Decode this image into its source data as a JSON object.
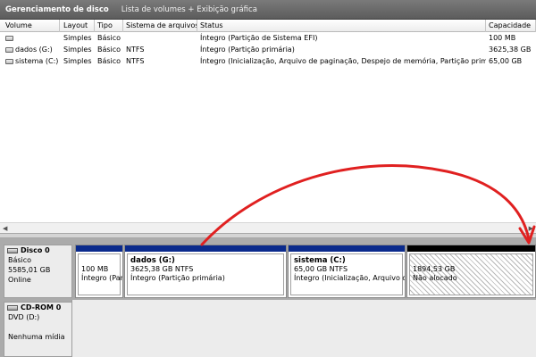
{
  "window": {
    "title": "Gerenciamento de disco",
    "view": "Lista de volumes + Exibição gráfica"
  },
  "list": {
    "columns": [
      "Volume",
      "Layout",
      "Tipo",
      "Sistema de arquivos",
      "Status",
      "Capacidade"
    ],
    "rows": [
      {
        "volume": "",
        "layout": "Simples",
        "tipo": "Básico",
        "fs": "",
        "status": "Íntegro (Partição de Sistema EFI)",
        "cap": "100 MB"
      },
      {
        "volume": "dados (G:)",
        "layout": "Simples",
        "tipo": "Básico",
        "fs": "NTFS",
        "status": "Íntegro (Partição primária)",
        "cap": "3625,38 GB"
      },
      {
        "volume": "sistema (C:)",
        "layout": "Simples",
        "tipo": "Básico",
        "fs": "NTFS",
        "status": "Íntegro (Inicialização, Arquivo de paginação, Despejo de memória, Partição primária)",
        "cap": "65,00 GB"
      }
    ]
  },
  "disk0": {
    "name": "Disco 0",
    "type": "Básico",
    "size": "5585,01 GB",
    "state": "Online",
    "partitions": [
      {
        "label": "",
        "size": "100 MB",
        "status": "Íntegro (Par"
      },
      {
        "label": "dados  (G:)",
        "size": "3625,38 GB NTFS",
        "status": "Íntegro (Partição primária)"
      },
      {
        "label": "sistema  (C:)",
        "size": "65,00 GB NTFS",
        "status": "Íntegro (Inicialização, Arquivo de"
      },
      {
        "label": "",
        "size": "1894,53 GB",
        "status": "Não alocado"
      }
    ]
  },
  "cdrom0": {
    "name": "CD-ROM 0",
    "drive": "DVD (D:)",
    "media": "Nenhuma mídia"
  },
  "annotation": {
    "color": "#e02020",
    "icon": "red-curved-arrow"
  }
}
